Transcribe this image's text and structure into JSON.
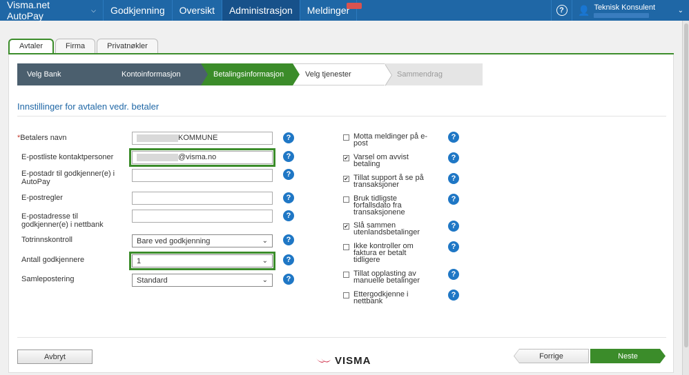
{
  "topnav": {
    "brand": "Visma.net AutoPay",
    "items": [
      {
        "label": "Godkjenning"
      },
      {
        "label": "Oversikt"
      },
      {
        "label": "Administrasjon"
      },
      {
        "label": "Meldinger"
      }
    ],
    "active_item": "Administrasjon",
    "help_glyph": "?",
    "user_name": "Teknisk Konsulent"
  },
  "tabs": [
    {
      "label": "Avtaler"
    },
    {
      "label": "Firma"
    },
    {
      "label": "Privatnøkler"
    }
  ],
  "active_tab": "Avtaler",
  "wizard": {
    "steps": [
      {
        "label": "Velg Bank",
        "state": "done"
      },
      {
        "label": "Kontoinformasjon",
        "state": "done"
      },
      {
        "label": "Betalingsinformasjon",
        "state": "current"
      },
      {
        "label": "Velg tjenester",
        "state": "todo"
      },
      {
        "label": "Sammendrag",
        "state": "disabled"
      }
    ]
  },
  "section_title": "Innstillinger for avtalen vedr. betaler",
  "form": {
    "required_mark": "*",
    "payer_name": {
      "label": "Betalers navn",
      "value": "KOMMUNE"
    },
    "email_contacts": {
      "label": "E-postliste kontaktpersoner",
      "value": "@visma.no"
    },
    "email_approvers_autopay": {
      "label": "E-postadr til godkjenner(e) i AutoPay",
      "value": ""
    },
    "email_rules": {
      "label": "E-postregler",
      "value": ""
    },
    "email_approvers_netbank": {
      "label": "E-postadresse til godkjenner(e) i nettbank",
      "value": ""
    },
    "two_step": {
      "label": "Totrinnskontroll",
      "value": "Bare ved godkjenning"
    },
    "num_approvers": {
      "label": "Antall godkjennere",
      "value": "1"
    },
    "collective_posting": {
      "label": "Samlepostering",
      "value": "Standard"
    }
  },
  "checkboxes": [
    {
      "label": "Motta meldinger på e-post",
      "checked": false
    },
    {
      "label": "Varsel om avvist betaling",
      "checked": true
    },
    {
      "label": "Tillat support å se på transaksjoner",
      "checked": true
    },
    {
      "label": "Bruk tidligste forfallsdato fra transaksjonene",
      "checked": false
    },
    {
      "label": "Slå sammen utenlandsbetalinger",
      "checked": true
    },
    {
      "label": "Ikke kontroller om faktura er betalt tidligere",
      "checked": false
    },
    {
      "label": "Tillat opplasting av manuelle betalinger",
      "checked": false
    },
    {
      "label": "Ettergodkjenne i nettbank",
      "checked": false
    }
  ],
  "check_glyph": "✔",
  "help_icon": "?",
  "footer": {
    "cancel": "Avbryt",
    "previous": "Forrige",
    "next": "Neste",
    "logo_text": "VISMA"
  },
  "colors": {
    "nav_blue": "#1f67a6",
    "accent_green": "#3b8c2a",
    "help_blue": "#1f77c5",
    "logo_red": "#c8102e"
  }
}
